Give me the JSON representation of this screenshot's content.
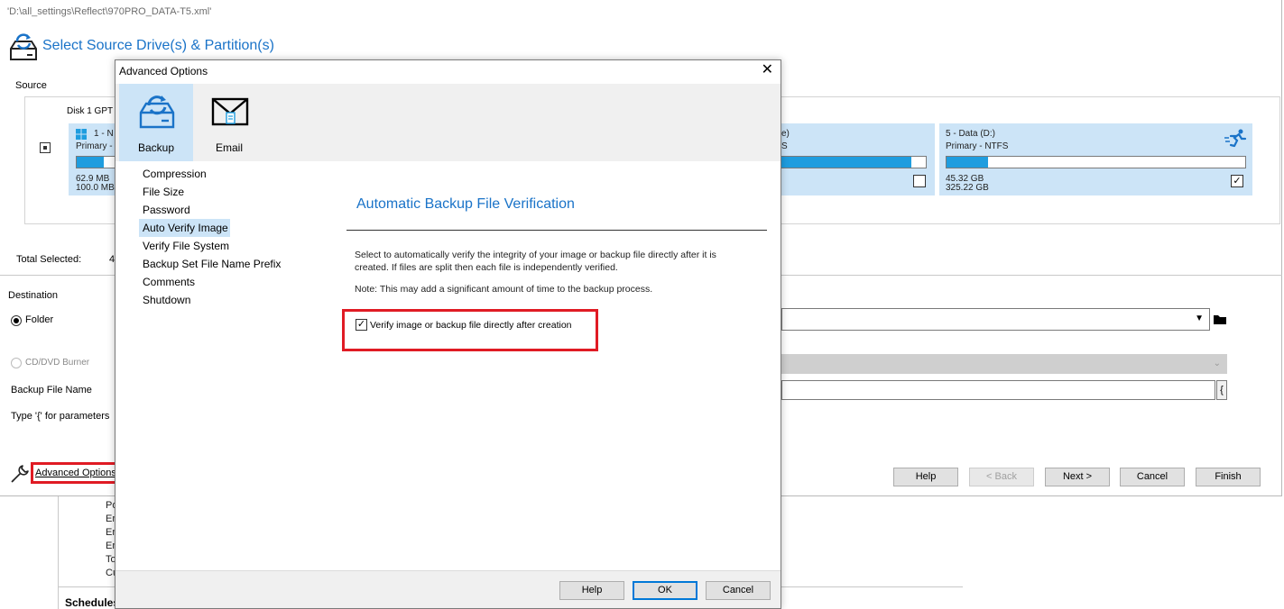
{
  "background": {
    "list_fragments": [
      "Po",
      "En",
      "En",
      "En",
      "To",
      "Cu"
    ],
    "schedules_label": "Schedules"
  },
  "wizard": {
    "path_title": "'D:\\all_settings\\Reflect\\970PRO_DATA-T5.xml'",
    "heading": "Select Source Drive(s) & Partition(s)",
    "source_label": "Source",
    "disk_label": "Disk 1 GPT [",
    "partitions": [
      {
        "name": "1 - N",
        "type": "Primary -",
        "used": "62.9 MB",
        "total": "100.0 MB",
        "fill_fraction": 0.63,
        "checked": true
      },
      {
        "name": "e)",
        "type": "S",
        "fill_fraction": 0.9,
        "checked": false
      },
      {
        "name": "5 - Data (D:)",
        "type": "Primary - NTFS",
        "used": "45.32 GB",
        "total": "325.22 GB",
        "fill_fraction": 0.14,
        "checked": true
      }
    ],
    "total_selected_label": "Total Selected:",
    "total_selected_value": "4",
    "destination_label": "Destination",
    "folder_label": "Folder",
    "cd_label": "CD/DVD Burner",
    "backup_file_name_label": "Backup File Name",
    "type_params_label": "Type '{' for parameters",
    "brace_label": "{",
    "advanced_options_label": "Advanced Options",
    "buttons": {
      "help": "Help",
      "back": "< Back",
      "next": "Next >",
      "cancel": "Cancel",
      "finish": "Finish"
    }
  },
  "dialog": {
    "title": "Advanced Options",
    "close_glyph": "✕",
    "toolbar": {
      "backup_label": "Backup",
      "email_label": "Email"
    },
    "nav_items": [
      "Compression",
      "File Size",
      "Password",
      "Auto Verify Image",
      "Verify File System",
      "Backup Set File Name Prefix",
      "Comments",
      "Shutdown"
    ],
    "selected_nav_index": 3,
    "section_title": "Automatic Backup File Verification",
    "description": "Select to automatically verify the integrity of your image or backup file directly after it is created. If files are split then each file is independently verified.",
    "note": "Note: This may add a significant amount of time to the backup process.",
    "verify_checkbox_label": "Verify image or backup file directly after creation",
    "verify_checked": true,
    "buttons": {
      "help": "Help",
      "ok": "OK",
      "cancel": "Cancel"
    }
  },
  "colors": {
    "accent": "#1a73c8",
    "selection": "#cce4f7",
    "highlight_border": "#e01b24",
    "bar_fill": "#1f9ddf"
  },
  "icons": {
    "wizard": "drive-refresh-icon",
    "backup": "drive-refresh-icon",
    "email": "envelope-icon",
    "wrench": "wrench-icon",
    "runner": "running-figure-icon",
    "folder": "folder-icon"
  }
}
